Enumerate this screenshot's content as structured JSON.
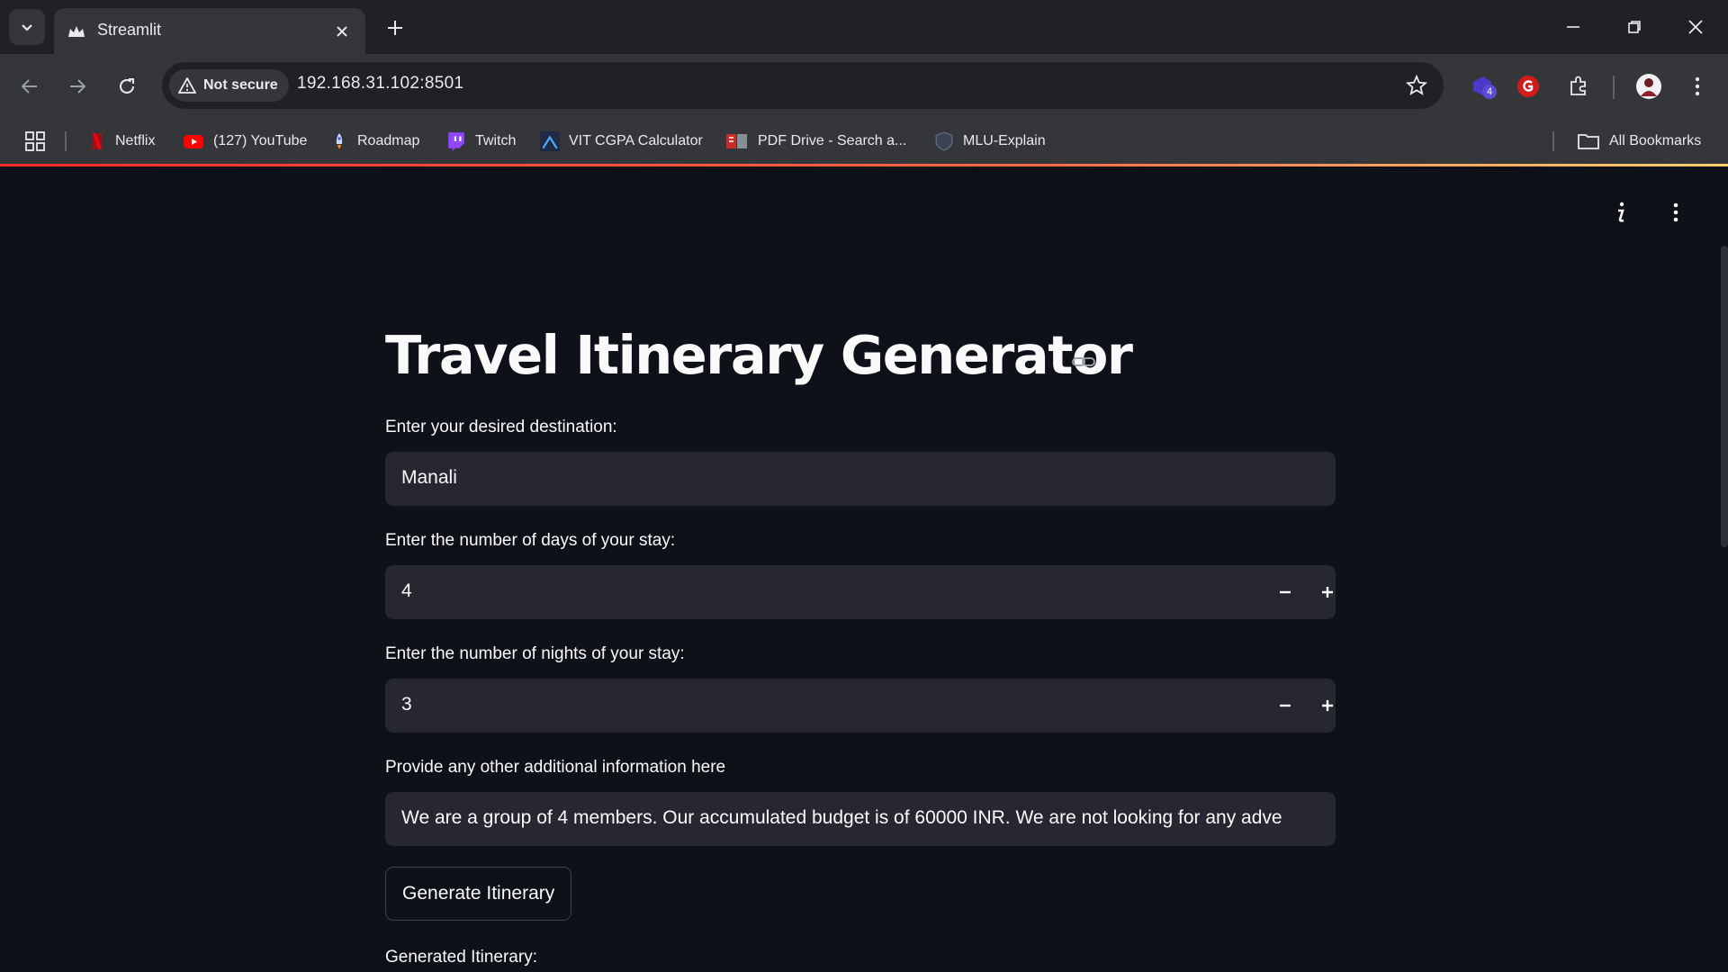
{
  "browser": {
    "tab_title": "Streamlit",
    "security_label": "Not secure",
    "url": "192.168.31.102:8501",
    "extension_badge": "4",
    "bookmarks": [
      {
        "label": "Netflix",
        "icon": "netflix-icon"
      },
      {
        "label": "(127) YouTube",
        "icon": "youtube-icon"
      },
      {
        "label": "Roadmap",
        "icon": "rocket-icon"
      },
      {
        "label": "Twitch",
        "icon": "twitch-icon"
      },
      {
        "label": "VIT CGPA Calculator",
        "icon": "calculator-icon"
      },
      {
        "label": "PDF Drive - Search a...",
        "icon": "pdf-icon"
      },
      {
        "label": "MLU-Explain",
        "icon": "shield-icon"
      }
    ],
    "all_bookmarks": "All Bookmarks"
  },
  "app": {
    "title": "Travel Itinerary Generator",
    "destination": {
      "label": "Enter your desired destination:",
      "value": "Manali"
    },
    "days": {
      "label": "Enter the number of days of your stay:",
      "value": "4"
    },
    "nights": {
      "label": "Enter the number of nights of your stay:",
      "value": "3"
    },
    "additional": {
      "label": "Provide any other additional information here",
      "value": "We are a group of 4 members. Our accumulated budget is of 60000 INR. We are not looking for any adve"
    },
    "generate_button": "Generate Itinerary",
    "output_label": "Generated Itinerary:"
  },
  "colors": {
    "app_bg": "#0e1117",
    "input_bg": "#262730",
    "chrome_dark": "#202124",
    "chrome_toolbar": "#35363a",
    "accent": "#ff4b4b"
  }
}
